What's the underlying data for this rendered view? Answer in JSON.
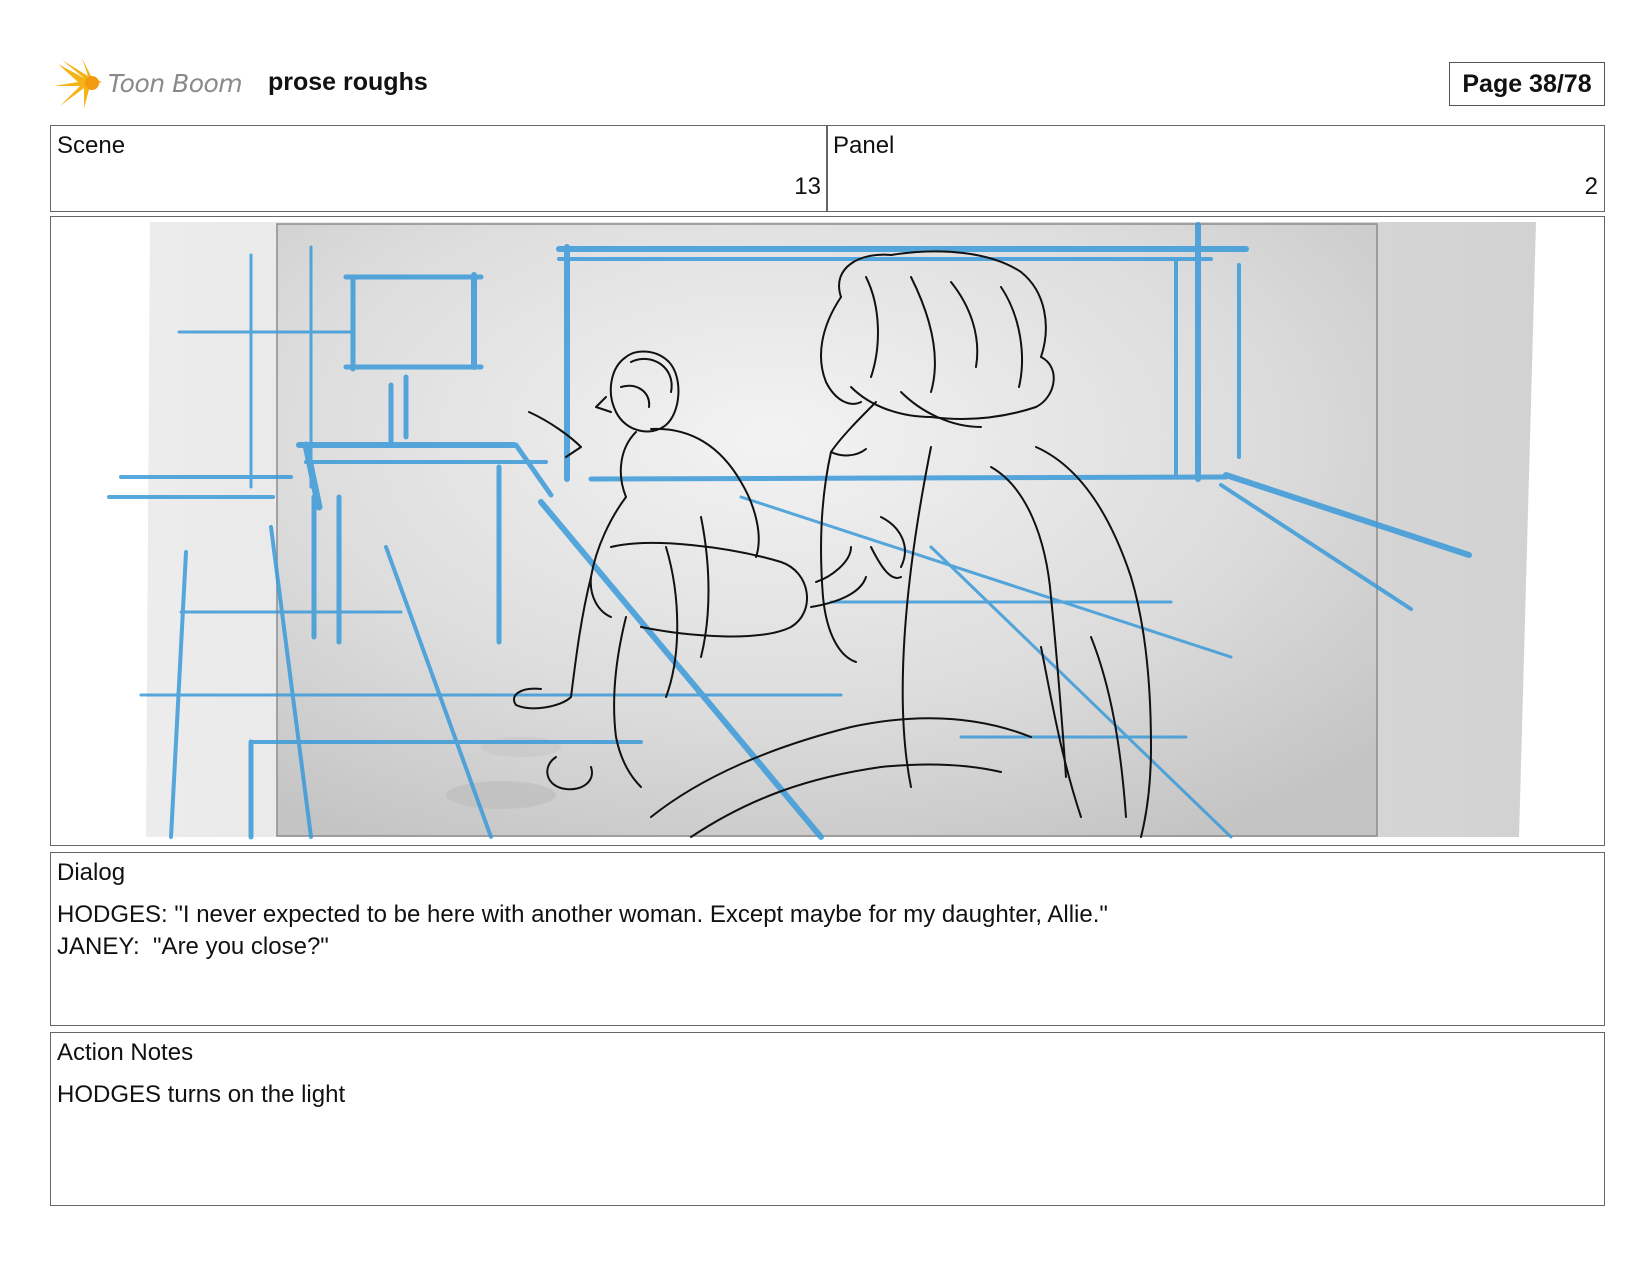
{
  "header": {
    "logo_text": "Toon Boom",
    "project_title": "prose roughs",
    "page_label": "Page 38/78"
  },
  "scene": {
    "label": "Scene",
    "value": "13"
  },
  "panel": {
    "label": "Panel",
    "value": "2"
  },
  "dialog": {
    "label": "Dialog",
    "lines": [
      "HODGES: \"I never expected to be here with another woman. Except maybe for my daughter, Allie.\"",
      "JANEY:  \"Are you close?\""
    ]
  },
  "action_notes": {
    "label": "Action Notes",
    "lines": [
      "HODGES turns on the light"
    ]
  },
  "colors": {
    "sketch_blue": "#3a9ad9",
    "sketch_black": "#111111",
    "border": "#666666"
  },
  "icons": {
    "logo": "starburst-logo-icon"
  }
}
